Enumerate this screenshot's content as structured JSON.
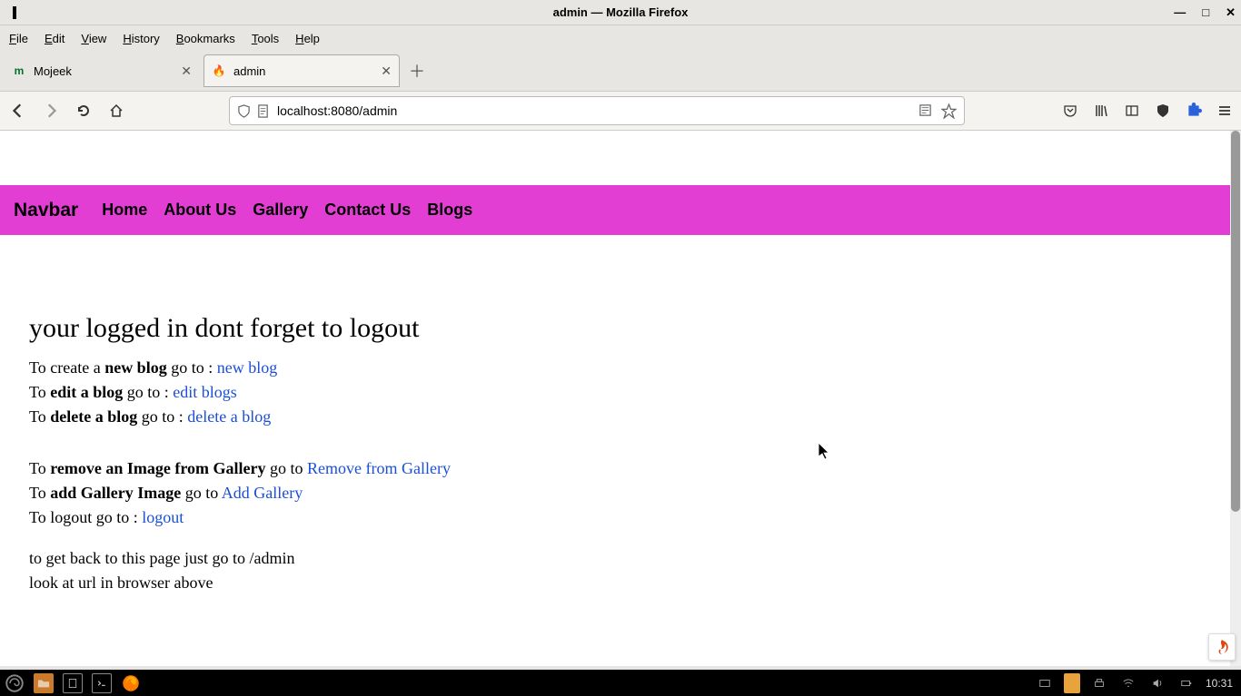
{
  "window": {
    "title": "admin — Mozilla Firefox",
    "controls": {
      "min": "—",
      "max": "□",
      "close": "✕"
    }
  },
  "menubar": [
    "File",
    "Edit",
    "View",
    "History",
    "Bookmarks",
    "Tools",
    "Help"
  ],
  "tabs": [
    {
      "label": "Mojeek",
      "favicon_text": "m",
      "favicon_color": "#0a6e2f",
      "active": false
    },
    {
      "label": "admin",
      "favicon_text": "🔥",
      "favicon_color": "#dd4814",
      "active": true
    }
  ],
  "newtab_label": "＋",
  "urlbar": {
    "url": "localhost:8080/admin"
  },
  "page": {
    "navbar": {
      "brand": "Navbar",
      "links": [
        "Home",
        "About Us",
        "Gallery",
        "Contact Us",
        "Blogs"
      ]
    },
    "heading": "your logged in dont forget to logout",
    "lines": {
      "l1_pre": "To create a ",
      "l1_bold": "new blog",
      "l1_mid": " go to : ",
      "l1_link": "new blog",
      "l2_pre": "To ",
      "l2_bold": "edit a blog",
      "l2_mid": " go to : ",
      "l2_link": "edit blogs",
      "l3_pre": "To ",
      "l3_bold": "delete a blog",
      "l3_mid": " go to : ",
      "l3_link": "delete a blog",
      "l4_pre": "To ",
      "l4_bold": "remove an Image from Gallery",
      "l4_mid": " go to ",
      "l4_link": "Remove from Gallery",
      "l5_pre": "To ",
      "l5_bold": "add Gallery Image",
      "l5_mid": " go to ",
      "l5_link": "Add Gallery",
      "l6_pre": "To logout go to : ",
      "l6_link": "logout",
      "l7": "to get back to this page just go to /admin",
      "l8": "look at url in browser above"
    }
  },
  "taskbar": {
    "clock": "10:31"
  }
}
